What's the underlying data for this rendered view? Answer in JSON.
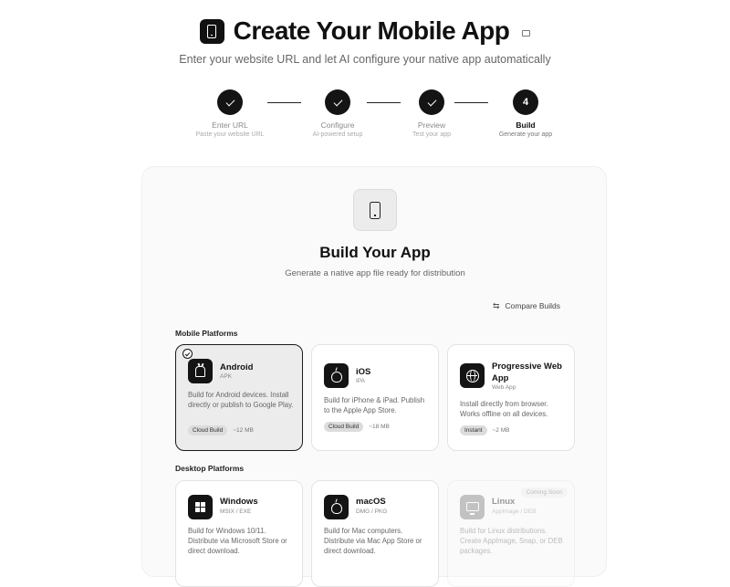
{
  "header": {
    "title": "Create Your Mobile App",
    "subtitle": "Enter your website URL and let AI configure your native app automatically"
  },
  "steps": [
    {
      "label": "Enter URL",
      "sub": "Paste your website URL",
      "status": "done"
    },
    {
      "label": "Configure",
      "sub": "AI-powered setup",
      "status": "done"
    },
    {
      "label": "Preview",
      "sub": "Test your app",
      "status": "done"
    },
    {
      "label": "Build",
      "sub": "Generate your app",
      "status": "active",
      "number": "4"
    }
  ],
  "build": {
    "title": "Build Your App",
    "subtitle": "Generate a native app file ready for distribution",
    "compare_label": "Compare Builds"
  },
  "sections": {
    "mobile": "Mobile Platforms",
    "desktop": "Desktop Platforms"
  },
  "mobile_platforms": [
    {
      "name": "Android",
      "ext": "APK",
      "desc": "Build for Android devices. Install directly or publish to Google Play.",
      "badge": "Cloud Build",
      "size": "~12 MB",
      "icon": "android-icon",
      "selected": true
    },
    {
      "name": "iOS",
      "ext": "IPA",
      "desc": "Build for iPhone & iPad. Publish to the Apple App Store.",
      "badge": "Cloud Build",
      "size": "~18 MB",
      "icon": "apple-icon"
    },
    {
      "name": "Progressive Web App",
      "ext": "Web App",
      "desc": "Install directly from browser. Works offline on all devices.",
      "badge": "Instant",
      "size": "~2 MB",
      "icon": "globe-icon"
    }
  ],
  "desktop_platforms": [
    {
      "name": "Windows",
      "ext": "MSIX / EXE",
      "desc": "Build for Windows 10/11. Distribute via Microsoft Store or direct download.",
      "icon": "windows-icon"
    },
    {
      "name": "macOS",
      "ext": "DMG / PKG",
      "desc": "Build for Mac computers. Distribute via Mac App Store or direct download.",
      "icon": "apple-icon"
    },
    {
      "name": "Linux",
      "ext": "AppImage / DEB",
      "desc": "Build for Linux distributions. Create AppImage, Snap, or DEB packages.",
      "icon": "monitor-icon",
      "coming": "Coming Soon",
      "disabled": true
    }
  ],
  "colors": {
    "accent": "#141414",
    "selected_bg": "#ececec",
    "muted": "#666666"
  }
}
